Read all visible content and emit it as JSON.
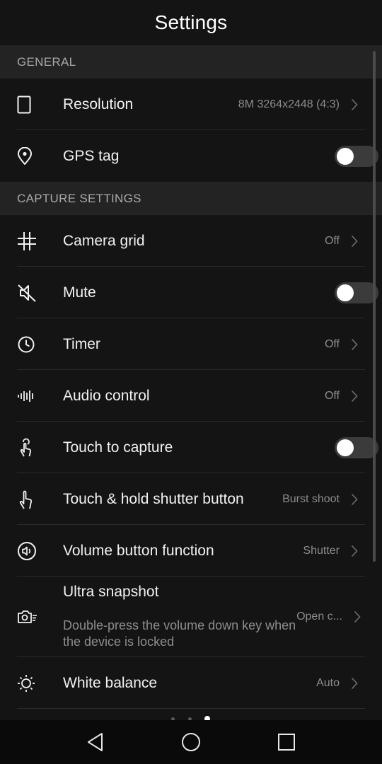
{
  "header": {
    "title": "Settings"
  },
  "sections": {
    "general": {
      "label": "GENERAL"
    },
    "capture": {
      "label": "CAPTURE SETTINGS"
    }
  },
  "items": {
    "resolution": {
      "label": "Resolution",
      "value": "8M 3264x2448 (4:3)",
      "icon": "phone-outline-icon"
    },
    "gps_tag": {
      "label": "GPS tag",
      "enabled": false,
      "icon": "location-pin-icon"
    },
    "camera_grid": {
      "label": "Camera grid",
      "value": "Off",
      "icon": "grid-icon"
    },
    "mute": {
      "label": "Mute",
      "enabled": false,
      "icon": "mute-icon"
    },
    "timer": {
      "label": "Timer",
      "value": "Off",
      "icon": "clock-icon"
    },
    "audio_control": {
      "label": "Audio control",
      "value": "Off",
      "icon": "audio-wave-icon"
    },
    "touch_to_capture": {
      "label": "Touch to capture",
      "enabled": false,
      "icon": "touch-icon"
    },
    "touch_hold": {
      "label": "Touch & hold shutter button",
      "value": "Burst shoot",
      "icon": "hand-icon"
    },
    "volume_button": {
      "label": "Volume button function",
      "value": "Shutter",
      "icon": "volume-icon"
    },
    "ultra_snapshot": {
      "label": "Ultra snapshot",
      "description": "Double-press the volume down key when the device is locked",
      "value": "Open c...",
      "icon": "camera-fast-icon"
    },
    "white_balance": {
      "label": "White balance",
      "value": "Auto",
      "icon": "sun-icon"
    }
  },
  "pager": {
    "count": 3,
    "active_index": 2
  },
  "colors": {
    "background": "#141414",
    "section_bg": "#232323",
    "secondary_text": "#8c8c8c"
  }
}
